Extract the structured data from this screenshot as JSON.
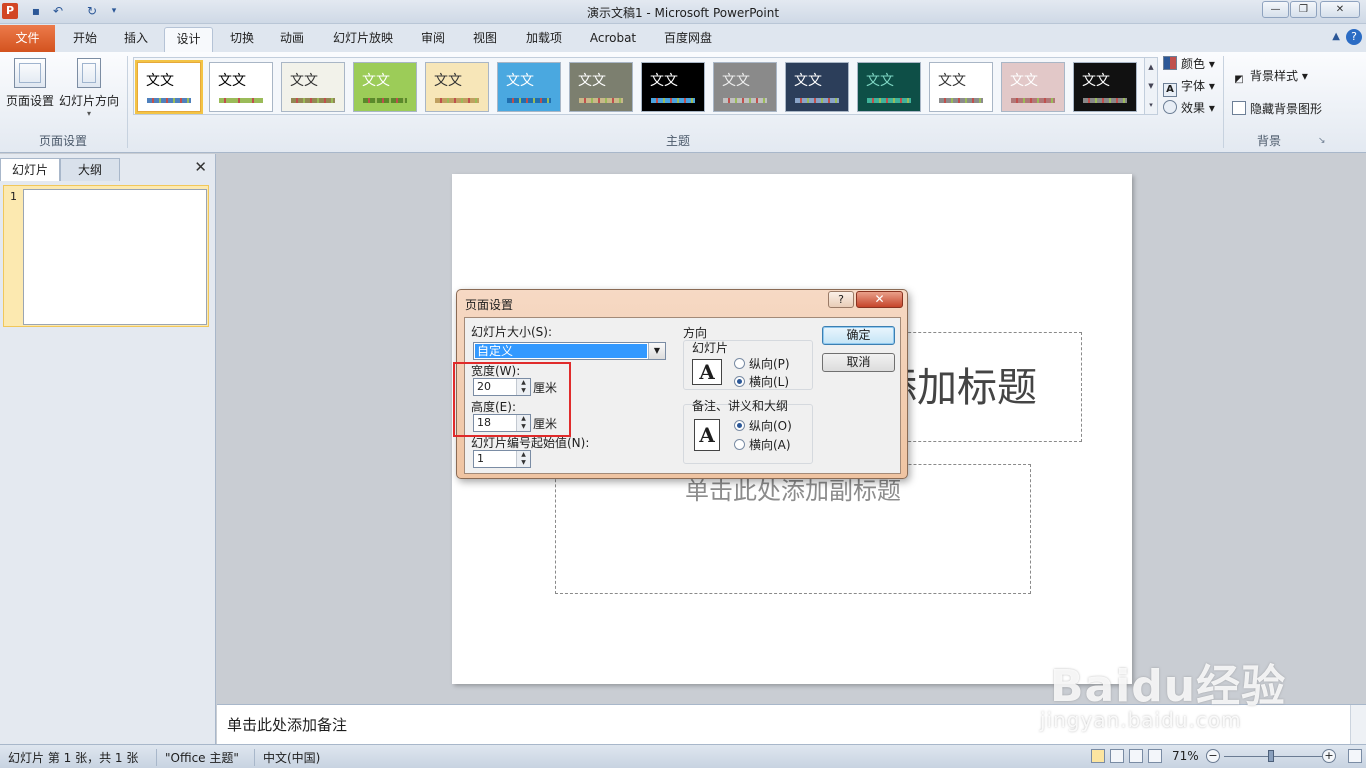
{
  "window": {
    "title": "演示文稿1  -  Microsoft PowerPoint",
    "app_icon": "P",
    "qat": [
      "save-icon",
      "undo-icon",
      "redo-icon",
      "customize-icon"
    ]
  },
  "tabs": [
    "文件",
    "开始",
    "插入",
    "设计",
    "切换",
    "动画",
    "幻灯片放映",
    "审阅",
    "视图",
    "加载项",
    "Acrobat",
    "百度网盘"
  ],
  "active_tab": "设计",
  "ribbon": {
    "page_setup_group": {
      "label": "页面设置",
      "buttons": [
        "页面设置",
        "幻灯片方向"
      ]
    },
    "themes_group": {
      "label": "主题",
      "thumb_text": "文文",
      "themes": [
        {
          "bg": "#ffffff",
          "fg": "#000000",
          "sw": "#4f81bd"
        },
        {
          "bg": "#ffffff",
          "fg": "#000000",
          "sw": "#9bbb59"
        },
        {
          "bg": "#f2f2ea",
          "fg": "#333333",
          "sw": "#938953"
        },
        {
          "bg": "#9ccc58",
          "fg": "#ffffff",
          "sw": "#5a8a2a"
        },
        {
          "bg": "#f7e6b8",
          "fg": "#333333",
          "sw": "#c0a060"
        },
        {
          "bg": "#4aa8e0",
          "fg": "#ffffff",
          "sw": "#1f6fb0"
        },
        {
          "bg": "#7c7f6f",
          "fg": "#ffffff",
          "sw": "#c9b98a"
        },
        {
          "bg": "#000000",
          "fg": "#ffffff",
          "sw": "#4aa3df"
        },
        {
          "bg": "#8a8a8a",
          "fg": "#eeeeee",
          "sw": "#c0c0c0"
        },
        {
          "bg": "#2c3e5a",
          "fg": "#ffffff",
          "sw": "#8aa4c8"
        },
        {
          "bg": "#0e4f47",
          "fg": "#7fd7c4",
          "sw": "#3fb39b"
        },
        {
          "bg": "#ffffff",
          "fg": "#333333",
          "sw": "#8c8c8c"
        },
        {
          "bg": "#e2c8c8",
          "fg": "#ffffff",
          "sw": "#b07878"
        },
        {
          "bg": "#111111",
          "fg": "#ffffff",
          "sw": "#888888"
        }
      ],
      "commands": [
        "颜色",
        "字体",
        "效果"
      ]
    },
    "background_group": {
      "label": "背景",
      "commands": [
        "背景样式",
        "隐藏背景图形"
      ]
    }
  },
  "left_pane": {
    "tabs": [
      "幻灯片",
      "大纲"
    ],
    "slide_number": "1"
  },
  "slide": {
    "title_placeholder": "单击此处添加标题",
    "subtitle_placeholder": "单击此处添加副标题"
  },
  "notes": "单击此处添加备注",
  "status_bar": {
    "slide_info": "幻灯片 第 1 张，共 1 张",
    "theme": "\"Office 主题\"",
    "language": "中文(中国)",
    "zoom": "71%",
    "zoom_level": 0.48
  },
  "dialog": {
    "title": "页面设置",
    "help": "?",
    "close": "✕",
    "slide_size_label": "幻灯片大小(S):",
    "slide_size_value": "自定义",
    "width_label": "宽度(W):",
    "width_value": "20",
    "height_label": "高度(E):",
    "height_value": "18",
    "unit": "厘米",
    "start_number_label": "幻灯片编号起始值(N):",
    "start_number_value": "1",
    "orientation_label": "方向",
    "slides_group": "幻灯片",
    "notes_group": "备注、讲义和大纲",
    "portrait": "纵向(P)",
    "landscape": "横向(L)",
    "portrait_o": "纵向(O)",
    "landscape_a": "横向(A)",
    "ok": "确定",
    "cancel": "取消"
  },
  "watermark": {
    "brand": "Baidu经验",
    "url": "jingyan.baidu.com"
  },
  "colors": {
    "accent_file_tab": "#d3531f",
    "highlight_box": "#e02b2b",
    "selection": "#3399ff"
  }
}
